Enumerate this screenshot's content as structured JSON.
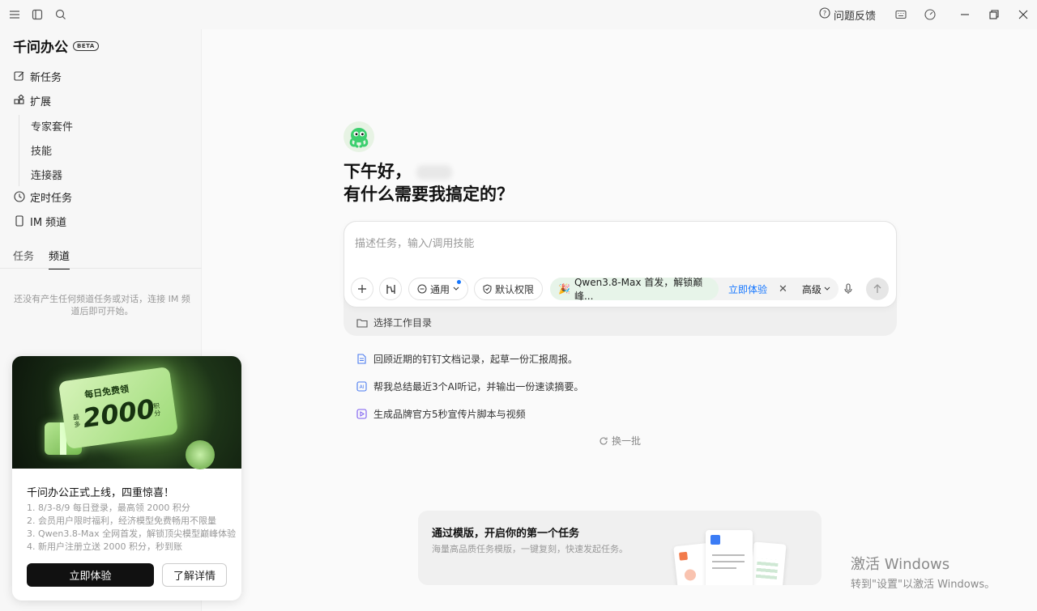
{
  "titlebar": {
    "feedback_label": "问题反馈",
    "icons": [
      "menu-icon",
      "sidebar-toggle-icon",
      "search-icon",
      "help-circle-icon",
      "keyboard-icon",
      "speed-icon",
      "minimize-icon",
      "restore-icon",
      "close-icon"
    ]
  },
  "sidebar": {
    "brand": "千问办公",
    "badge": "BETA",
    "nav": [
      {
        "label": "新任务",
        "icon": "edit-icon"
      },
      {
        "label": "扩展",
        "icon": "extension-icon"
      },
      {
        "label": "定时任务",
        "icon": "clock-icon"
      },
      {
        "label": "IM 频道",
        "icon": "phone-icon"
      }
    ],
    "extension_sub": [
      "专家套件",
      "技能",
      "连接器"
    ],
    "tabs": [
      "任务",
      "频道"
    ],
    "active_tab": "频道",
    "empty_message": "还没有产生任何频道任务或对话，连接 IM 频道后即可开始。"
  },
  "promo_card": {
    "ticket_top": "每日免费领",
    "ticket_most": "最多",
    "ticket_value": "2000",
    "ticket_unit": "积分",
    "title": "千问办公正式上线，四重惊喜！",
    "items": [
      "1. 8/3-8/9 每日登录，最高领 2000 积分",
      "2. 会员用户限时福利，经济模型免费畅用不限量",
      "3. Qwen3.8-Max 全网首发，解锁顶尖模型巅峰体验",
      "4. 新用户注册立送 2000 积分，秒到账"
    ],
    "primary_button": "立即体验",
    "secondary_button": "了解详情"
  },
  "main": {
    "greeting_line1": "下午好，",
    "greeting_line2": "有什么需要我搞定的？",
    "composer": {
      "placeholder": "描述任务，输入/调用技能",
      "mode_label": "通用",
      "permission_label": "默认权限",
      "promo_text": "Qwen3.8-Max 首发，解锁巅峰...",
      "promo_action": "立即体验",
      "advanced_label": "高级",
      "accent": "#1677ff"
    },
    "workdir_label": "选择工作目录",
    "suggestions": [
      {
        "text": "回顾近期的钉钉文档记录，起草一份汇报周报。",
        "icon": "document-icon"
      },
      {
        "text": "帮我总结最近3个AI听记，并输出一份速读摘要。",
        "icon": "ai-note-icon"
      },
      {
        "text": "生成品牌官方5秒宣传片脚本与视频",
        "icon": "video-icon"
      }
    ],
    "refresh_label": "换一批",
    "template_card": {
      "title": "通过模版，开启你的第一个任务",
      "subtitle": "海量高品质任务模版，一键复刻，快速发起任务。"
    }
  },
  "watermark": {
    "line1": "激活 Windows",
    "line2": "转到\"设置\"以激活 Windows。"
  }
}
